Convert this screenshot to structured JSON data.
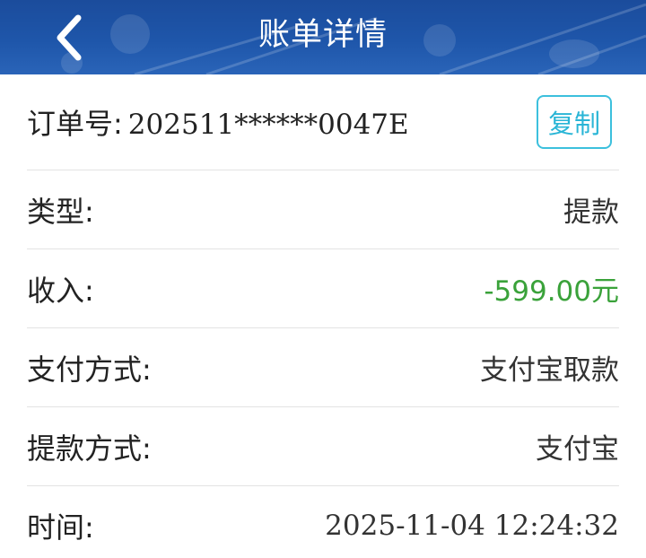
{
  "header": {
    "title": "账单详情",
    "back_icon": "chevron-left-icon"
  },
  "order": {
    "label": "订单号:",
    "number": "202511******0047E",
    "copy_label": "复制"
  },
  "rows": [
    {
      "label": "类型:",
      "value": "提款"
    },
    {
      "label": "收入:",
      "value": "-599.00元"
    },
    {
      "label": "支付方式:",
      "value": "支付宝取款"
    },
    {
      "label": "提款方式:",
      "value": "支付宝"
    },
    {
      "label": "时间:",
      "value": "2025-11-04 12:24:32"
    }
  ],
  "colors": {
    "header_bg": "#1e56aa",
    "income": "#3aa23a",
    "copy_accent": "#29b5d6"
  }
}
